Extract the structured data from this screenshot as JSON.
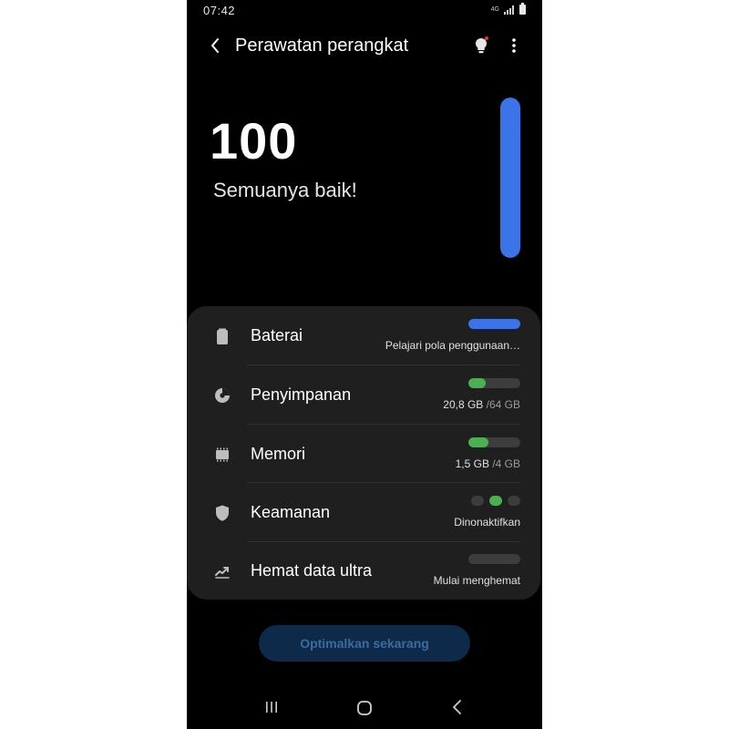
{
  "status_bar": {
    "time": "07:42",
    "network": "4G"
  },
  "header": {
    "title": "Perawatan perangkat"
  },
  "score": {
    "value": "100",
    "status": "Semuanya baik!",
    "gauge_level": 1.0
  },
  "colors": {
    "accent_blue": "#3b73e8",
    "green": "#4caf50",
    "card_bg": "#1f1f1f",
    "track": "#3d3d3d"
  },
  "items": [
    {
      "label": "Baterai",
      "icon": "battery-icon",
      "indicator": "bar",
      "fill": 1.0,
      "fill_color": "#3b73e8",
      "sub": "Pelajari pola penggunaan…"
    },
    {
      "label": "Penyimpanan",
      "icon": "storage-pie-icon",
      "indicator": "bar",
      "fill": 0.33,
      "fill_color": "#4caf50",
      "sub_value": "20,8 GB",
      "sub_total": "/64 GB"
    },
    {
      "label": "Memori",
      "icon": "memory-chip-icon",
      "indicator": "bar",
      "fill": 0.38,
      "fill_color": "#4caf50",
      "sub_value": "1,5 GB",
      "sub_total": "/4 GB"
    },
    {
      "label": "Keamanan",
      "icon": "shield-icon",
      "indicator": "dots",
      "active_dot": 2,
      "sub": "Dinonaktifkan"
    },
    {
      "label": "Hemat data ultra",
      "icon": "data-saver-icon",
      "indicator": "bar",
      "fill": 0,
      "fill_color": "#3d3d3d",
      "sub": "Mulai menghemat"
    }
  ],
  "optimize_button": {
    "label": "Optimalkan sekarang"
  }
}
